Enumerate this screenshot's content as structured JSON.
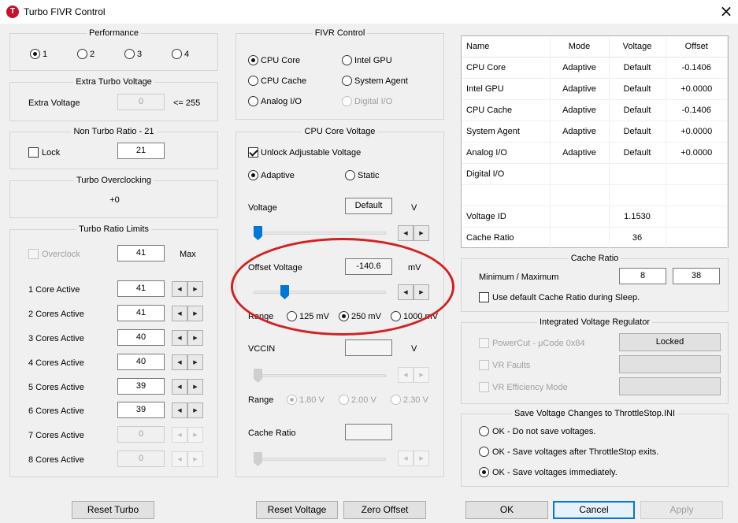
{
  "window": {
    "title": "Turbo FIVR Control",
    "app_icon": "T"
  },
  "performance": {
    "title": "Performance",
    "options": [
      "1",
      "2",
      "3",
      "4"
    ]
  },
  "extra_turbo": {
    "title": "Extra Turbo Voltage",
    "label": "Extra Voltage",
    "value": "0",
    "limit": "<= 255"
  },
  "non_turbo": {
    "title": "Non Turbo Ratio - 21",
    "lock_label": "Lock",
    "value": "21"
  },
  "turbo_oc": {
    "title": "Turbo Overclocking",
    "value": "+0"
  },
  "turbo_ratio": {
    "title": "Turbo Ratio Limits",
    "overclock_label": "Overclock",
    "overclock_value": "41",
    "max_label": "Max",
    "rows": [
      {
        "label": "1 Core Active",
        "value": "41"
      },
      {
        "label": "2 Cores Active",
        "value": "41"
      },
      {
        "label": "3 Cores Active",
        "value": "40"
      },
      {
        "label": "4 Cores Active",
        "value": "40"
      },
      {
        "label": "5 Cores Active",
        "value": "39"
      },
      {
        "label": "6 Cores Active",
        "value": "39"
      },
      {
        "label": "7 Cores Active",
        "value": "0"
      },
      {
        "label": "8 Cores Active",
        "value": "0"
      }
    ],
    "reset_label": "Reset Turbo"
  },
  "fivr": {
    "title": "FIVR Control",
    "options": [
      "CPU Core",
      "Intel GPU",
      "CPU Cache",
      "System Agent",
      "Analog I/O",
      "Digital I/O"
    ]
  },
  "core_voltage": {
    "title": "CPU Core Voltage",
    "unlock_label": "Unlock Adjustable Voltage",
    "adaptive_label": "Adaptive",
    "static_label": "Static",
    "voltage_label": "Voltage",
    "voltage_value": "Default",
    "voltage_unit": "V",
    "offset_label": "Offset Voltage",
    "offset_value": "-140.6",
    "offset_unit": "mV",
    "range_label": "Range",
    "range_options": [
      "125 mV",
      "250 mV",
      "1000 mV"
    ],
    "vccin_label": "VCCIN",
    "vccin_value": "",
    "vccin_unit": "V",
    "range2_label": "Range",
    "range2_options": [
      "1.80 V",
      "2.00 V",
      "2.30 V"
    ],
    "cache_ratio_label": "Cache Ratio",
    "cache_ratio_value": "",
    "reset_label": "Reset Voltage",
    "zero_label": "Zero Offset"
  },
  "table": {
    "headers": [
      "Name",
      "Mode",
      "Voltage",
      "Offset"
    ],
    "rows": [
      [
        "CPU Core",
        "Adaptive",
        "Default",
        "-0.1406"
      ],
      [
        "Intel GPU",
        "Adaptive",
        "Default",
        "+0.0000"
      ],
      [
        "CPU Cache",
        "Adaptive",
        "Default",
        "-0.1406"
      ],
      [
        "System Agent",
        "Adaptive",
        "Default",
        "+0.0000"
      ],
      [
        "Analog I/O",
        "Adaptive",
        "Default",
        "+0.0000"
      ],
      [
        "Digital I/O",
        "",
        "",
        ""
      ],
      [
        "",
        "",
        "",
        ""
      ],
      [
        "Voltage ID",
        "",
        "1.1530",
        ""
      ],
      [
        "Cache Ratio",
        "",
        "36",
        ""
      ]
    ]
  },
  "cache_ratio": {
    "title": "Cache Ratio",
    "label": "Minimum / Maximum",
    "min": "8",
    "max": "38",
    "sleep_label": "Use default Cache Ratio during Sleep."
  },
  "ivr": {
    "title": "Integrated Voltage Regulator",
    "powercut_label": "PowerCut  -  μCode 0x84",
    "locked_label": "Locked",
    "vr_faults_label": "VR Faults",
    "vr_eff_label": "VR Efficiency Mode"
  },
  "save": {
    "title": "Save Voltage Changes to ThrottleStop.INI",
    "options": [
      "OK - Do not save voltages.",
      "OK - Save voltages after ThrottleStop exits.",
      "OK - Save voltages immediately."
    ]
  },
  "footer": {
    "ok": "OK",
    "cancel": "Cancel",
    "apply": "Apply"
  },
  "colors": {
    "accent": "#0078d7",
    "annotation": "#d42020"
  }
}
